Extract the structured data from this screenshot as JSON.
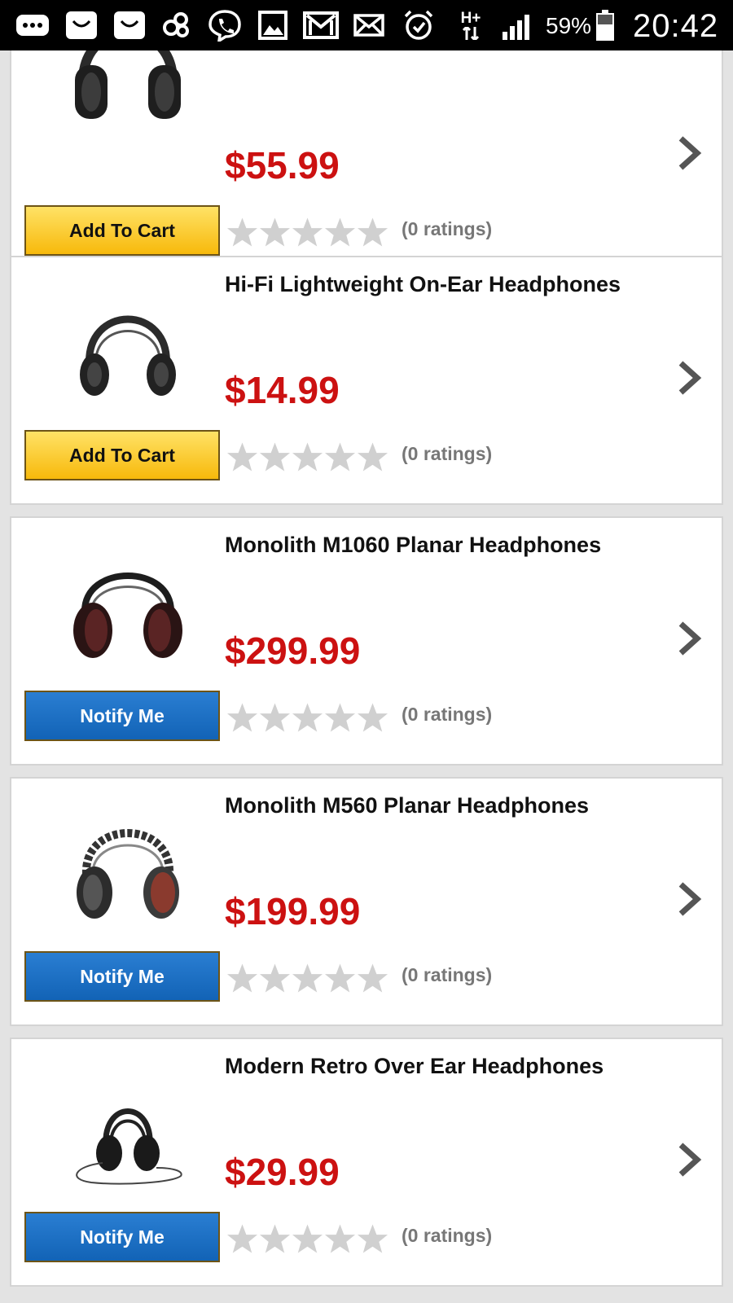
{
  "status_bar": {
    "icons": [
      "chat-bubble-icon",
      "box-app-icon",
      "box-app-icon",
      "infinity-icon",
      "viber-icon",
      "gallery-icon",
      "gmail-icon",
      "mail-icon",
      "alarm-icon",
      "hplus-data-icon",
      "signal-icon",
      "battery-icon"
    ],
    "network_label": "H+",
    "battery_percent": "59%",
    "time": "20:42"
  },
  "products": [
    {
      "title": "",
      "price": "$55.99",
      "button_label": "Add To Cart",
      "button_kind": "cart",
      "rating_stars": 0,
      "ratings_text": "(0 ratings)"
    },
    {
      "title": "Hi-Fi Lightweight On-Ear Headphones",
      "price": "$14.99",
      "button_label": "Add To Cart",
      "button_kind": "cart",
      "rating_stars": 0,
      "ratings_text": "(0 ratings)"
    },
    {
      "title": "Monolith M1060 Planar Headphones",
      "price": "$299.99",
      "button_label": "Notify Me",
      "button_kind": "notify",
      "rating_stars": 0,
      "ratings_text": "(0 ratings)"
    },
    {
      "title": "Monolith M560 Planar Headphones",
      "price": "$199.99",
      "button_label": "Notify Me",
      "button_kind": "notify",
      "rating_stars": 0,
      "ratings_text": "(0 ratings)"
    },
    {
      "title": "Modern Retro Over Ear Headphones",
      "price": "$29.99",
      "button_label": "Notify Me",
      "button_kind": "notify",
      "rating_stars": 0,
      "ratings_text": "(0 ratings)"
    }
  ],
  "colors": {
    "price": "#cc1111",
    "cart_button": "#f7b90b",
    "notify_button": "#1263b6",
    "star_empty": "#d0d0d0"
  }
}
